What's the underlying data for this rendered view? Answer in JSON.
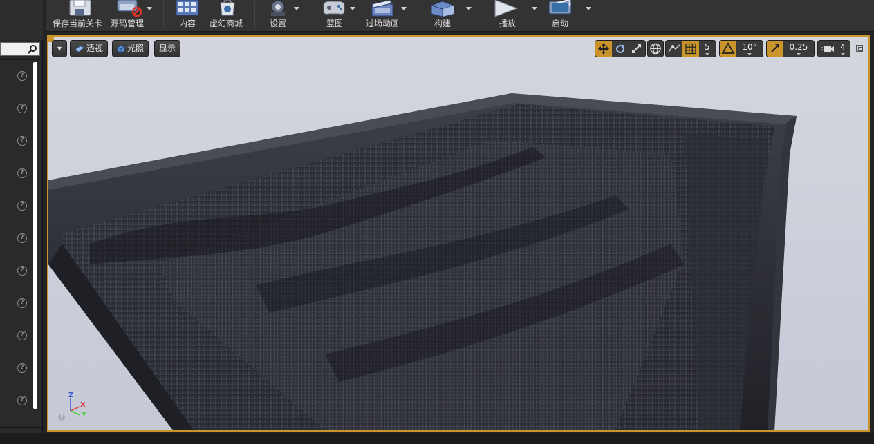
{
  "toolbar": {
    "items": [
      {
        "label": "保存当前关卡",
        "icon": "save-icon"
      },
      {
        "label": "源码管理",
        "icon": "source-control-icon"
      },
      {
        "label": "内容",
        "icon": "content-icon"
      },
      {
        "label": "虚幻商城",
        "icon": "marketplace-icon"
      },
      {
        "label": "设置",
        "icon": "settings-icon"
      },
      {
        "label": "蓝图",
        "icon": "blueprint-icon"
      },
      {
        "label": "过场动画",
        "icon": "cinematics-icon"
      },
      {
        "label": "构建",
        "icon": "build-icon"
      },
      {
        "label": "播放",
        "icon": "play-icon"
      },
      {
        "label": "启动",
        "icon": "launch-icon"
      }
    ]
  },
  "viewport": {
    "view_mode_menu": "▾",
    "perspective_label": "透视",
    "lighting_label": "光照",
    "show_label": "显示",
    "grid_snap_value": "5",
    "rotation_snap_value": "10°",
    "scale_snap_value": "0.25",
    "camera_speed_value": "4",
    "accent_color": "#c9952a",
    "axis": {
      "z": "Z",
      "x": "X",
      "y": "Y"
    }
  },
  "left_panel": {
    "help_icon_glyph": "?",
    "help_icons": 11
  }
}
